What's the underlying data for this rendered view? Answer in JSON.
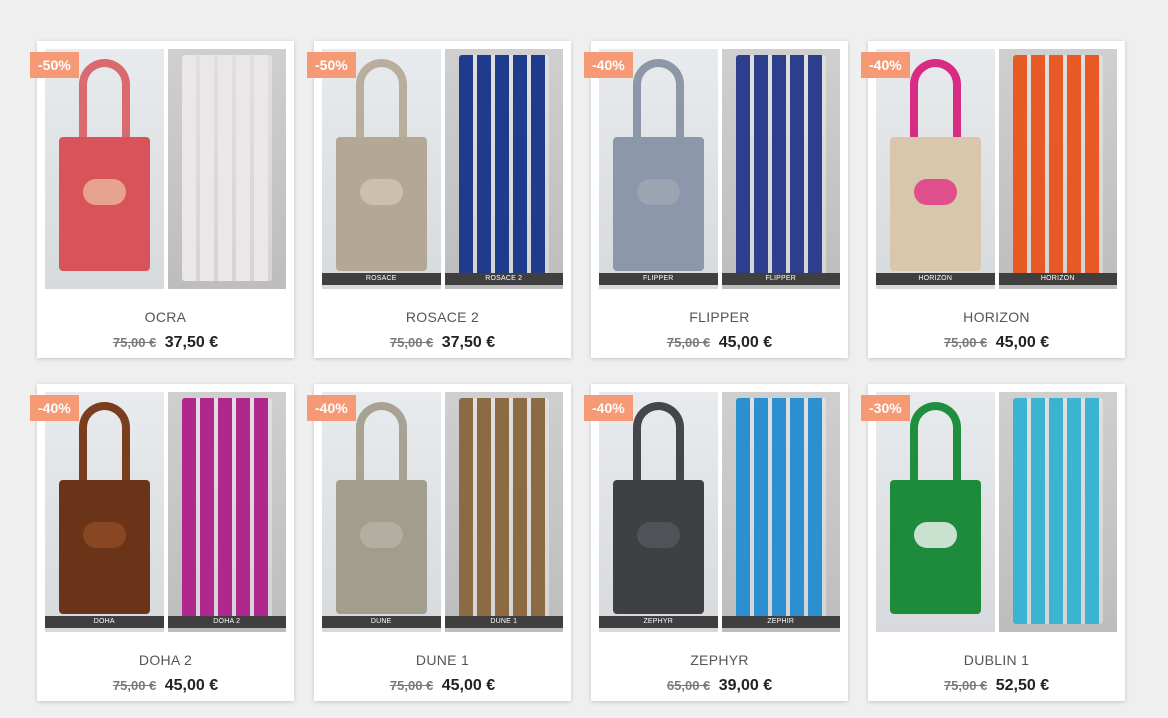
{
  "products": [
    {
      "badge": "-50%",
      "name": "OCRA",
      "old_price": "75,00 €",
      "price": "37,50 €",
      "caption_bag": "",
      "caption_towel": "",
      "bag_color": "#d9535a",
      "handle_color": "#d96a6f",
      "bow_color": "#e9b09a",
      "towel_color": "#ebe7e6"
    },
    {
      "badge": "-50%",
      "name": "ROSACE 2",
      "old_price": "75,00 €",
      "price": "37,50 €",
      "caption_bag": "ROSACE",
      "caption_towel": "ROSACE 2",
      "bag_color": "#b3a896",
      "handle_color": "#b9ad9b",
      "bow_color": "#cfc4b3",
      "towel_color": "#1f3b8c"
    },
    {
      "badge": "-40%",
      "name": "FLIPPER",
      "old_price": "75,00 €",
      "price": "45,00 €",
      "caption_bag": "FLIPPER",
      "caption_towel": "FLIPPER",
      "bag_color": "#8c97ac",
      "handle_color": "#8d97a7",
      "bow_color": "#9fa6b3",
      "towel_color": "#2d3f8c"
    },
    {
      "badge": "-40%",
      "name": "HORIZON",
      "old_price": "75,00 €",
      "price": "45,00 €",
      "caption_bag": "HORIZON",
      "caption_towel": "HORIZON",
      "bag_color": "#d8c6ad",
      "handle_color": "#d62d82",
      "bow_color": "#e03a86",
      "towel_color": "#e65a23"
    },
    {
      "badge": "-40%",
      "name": "DOHA 2",
      "old_price": "75,00 €",
      "price": "45,00 €",
      "caption_bag": "DOHA",
      "caption_towel": "DOHA 2",
      "bag_color": "#6b3419",
      "handle_color": "#7a3d1d",
      "bow_color": "#8e4a25",
      "towel_color": "#b0288e"
    },
    {
      "badge": "-40%",
      "name": "DUNE 1",
      "old_price": "75,00 €",
      "price": "45,00 €",
      "caption_bag": "DUNE",
      "caption_towel": "DUNE 1",
      "bag_color": "#a29d8d",
      "handle_color": "#a7a293",
      "bow_color": "#b6b1a3",
      "towel_color": "#8b6a44"
    },
    {
      "badge": "-40%",
      "name": "ZEPHYR",
      "old_price": "65,00 €",
      "price": "39,00 €",
      "caption_bag": "ZEPHYR",
      "caption_towel": "ZEPHIR",
      "bag_color": "#3f4044",
      "handle_color": "#45464a",
      "bow_color": "#55565a",
      "towel_color": "#2c8fd1"
    },
    {
      "badge": "-30%",
      "name": "DUBLIN 1",
      "old_price": "75,00 €",
      "price": "52,50 €",
      "caption_bag": "",
      "caption_towel": "",
      "bag_color": "#1e8a3c",
      "handle_color": "#1f8f3f",
      "bow_color": "#e8f0e9",
      "towel_color": "#3bb4d4"
    }
  ]
}
